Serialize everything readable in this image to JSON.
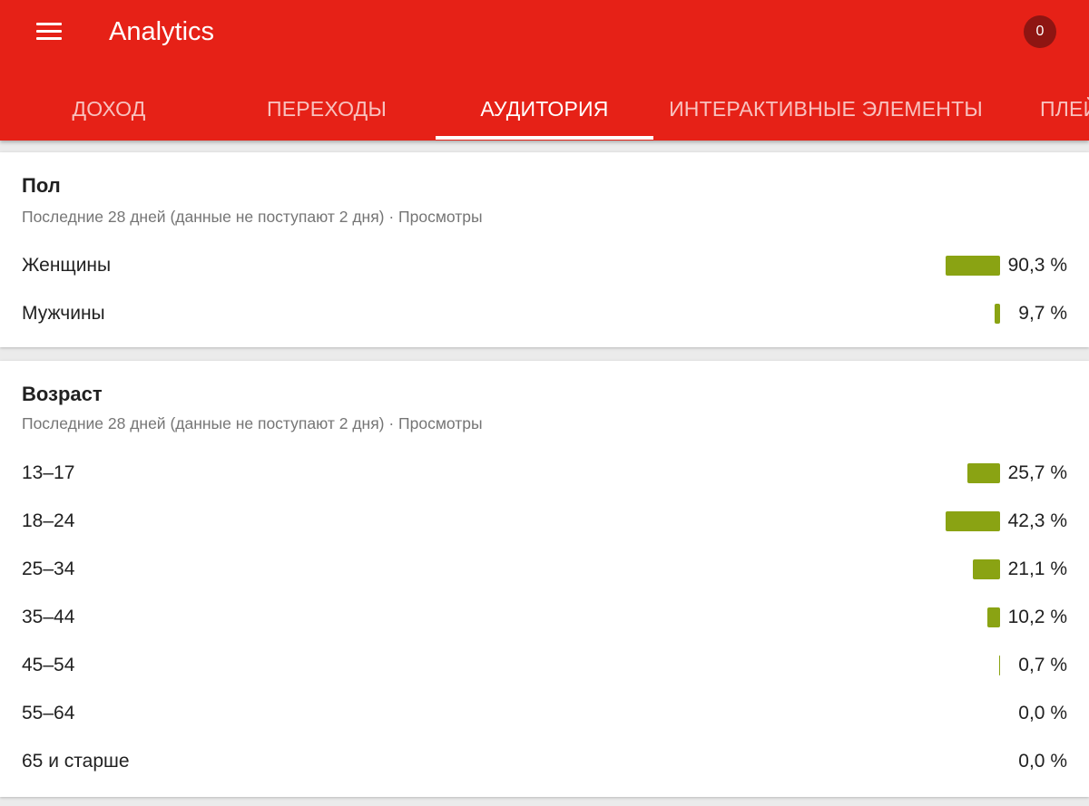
{
  "app": {
    "title": "Analytics",
    "notification_count": "0"
  },
  "tabs": [
    {
      "label": "ДОХОД",
      "active": false
    },
    {
      "label": "ПЕРЕХОДЫ",
      "active": false
    },
    {
      "label": "АУДИТОРИЯ",
      "active": true
    },
    {
      "label": "ИНТЕРАКТИВНЫЕ ЭЛЕМЕНТЫ",
      "active": false
    },
    {
      "label": "ПЛЕЙ",
      "active": false
    }
  ],
  "gender": {
    "title": "Пол",
    "subtitle": "Последние 28 дней (данные не поступают 2 дня) · Просмотры",
    "rows": [
      {
        "label": "Женщины",
        "value": "90,3 %",
        "percent": 90.3
      },
      {
        "label": "Мужчины",
        "value": "9,7 %",
        "percent": 9.7
      }
    ]
  },
  "age": {
    "title": "Возраст",
    "subtitle": "Последние 28 дней (данные не поступают 2 дня) · Просмотры",
    "rows": [
      {
        "label": "13–17",
        "value": "25,7 %",
        "percent": 25.7
      },
      {
        "label": "18–24",
        "value": "42,3 %",
        "percent": 42.3
      },
      {
        "label": "25–34",
        "value": "21,1 %",
        "percent": 21.1
      },
      {
        "label": "35–44",
        "value": "10,2 %",
        "percent": 10.2
      },
      {
        "label": "45–54",
        "value": "0,7 %",
        "percent": 0.7
      },
      {
        "label": "55–64",
        "value": "0,0 %",
        "percent": 0.0
      },
      {
        "label": "65 и старше",
        "value": "0,0 %",
        "percent": 0.0
      }
    ]
  },
  "colors": {
    "appbar": "#e62117",
    "bar": "#8aa313",
    "badge": "#8e1512"
  }
}
